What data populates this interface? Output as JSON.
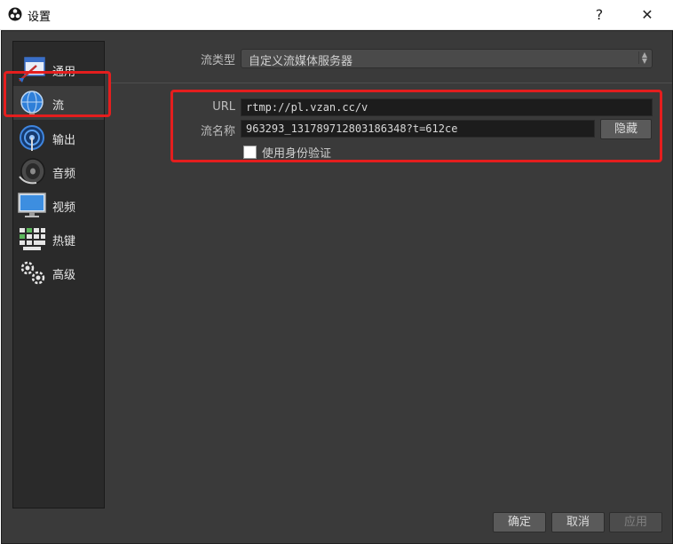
{
  "window": {
    "title": "设置",
    "help_label": "?",
    "close_label": "✕"
  },
  "sidebar": {
    "items": [
      {
        "label": "通用",
        "icon": "general-icon"
      },
      {
        "label": "流",
        "icon": "stream-globe-icon"
      },
      {
        "label": "输出",
        "icon": "output-icon"
      },
      {
        "label": "音频",
        "icon": "audio-speaker-icon"
      },
      {
        "label": "视频",
        "icon": "video-monitor-icon"
      },
      {
        "label": "热键",
        "icon": "hotkeys-keyboard-icon"
      },
      {
        "label": "高级",
        "icon": "advanced-gears-icon"
      }
    ],
    "selected": "流"
  },
  "stream": {
    "type_label": "流类型",
    "type_value": "自定义流媒体服务器",
    "url_label": "URL",
    "url_value": "rtmp://pl.vzan.cc/v",
    "key_label": "流名称",
    "key_value": "963293_131789712803186348?t=612ce",
    "hide_label": "隐藏",
    "auth_label": "使用身份验证",
    "auth_checked": false
  },
  "footer": {
    "ok_label": "确定",
    "cancel_label": "取消",
    "apply_label": "应用"
  },
  "colors": {
    "highlight": "#e41e1e",
    "panel_bg": "#3a3a3a",
    "sidebar_bg": "#2a2a2a"
  }
}
